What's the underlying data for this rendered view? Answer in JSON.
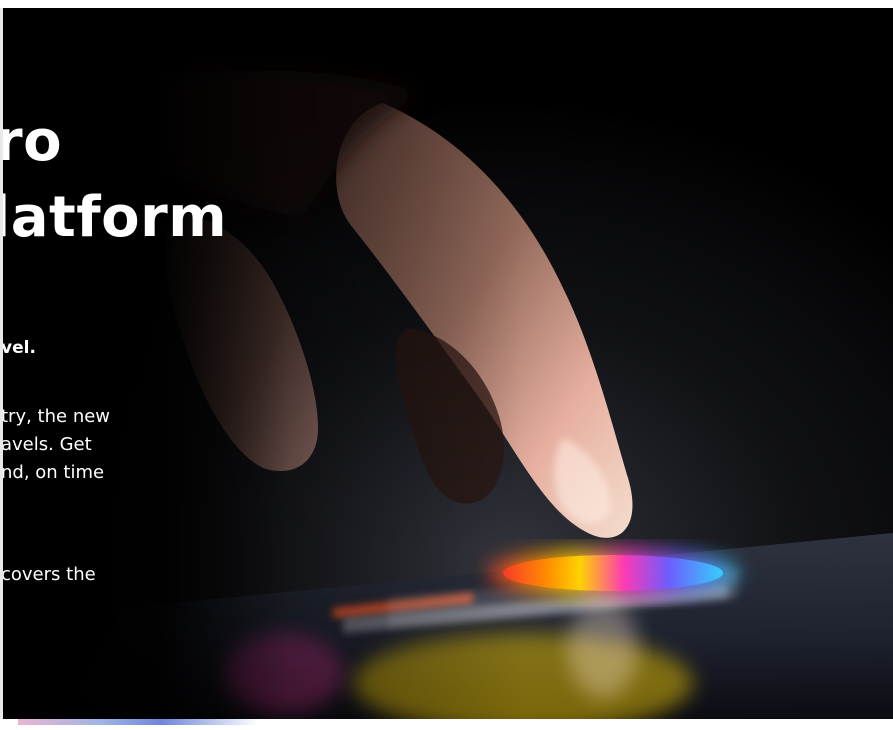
{
  "hero": {
    "headline_line1": "ro",
    "headline_line2": "latform",
    "subhead": "vel.",
    "body_lines": [
      "try, the new",
      "avels. Get",
      "nd, on time"
    ],
    "footer": "covers the"
  },
  "image": {
    "icon": "touchscreen-hand-icon",
    "accent_colors": [
      "#ff4a2b",
      "#ff8c00",
      "#ffd700",
      "#3cc6ff",
      "#6b5cff",
      "#ff3aa8"
    ]
  }
}
